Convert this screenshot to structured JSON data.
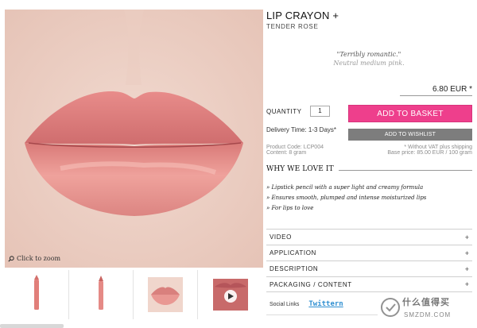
{
  "product": {
    "title": "LIP CRAYON +",
    "shade": "TENDER ROSE",
    "quote_primary": "\"Terribly romantic.\"",
    "quote_secondary": "Neutral medium pink.",
    "price": "6.80 EUR *"
  },
  "purchase": {
    "quantity_label": "QUANTITY",
    "quantity_value": "1",
    "add_to_basket": "ADD TO BASKET",
    "add_to_wishlist": "ADD TO WISHLIST",
    "delivery_time": "Delivery Time: 1-3 Days*"
  },
  "meta": {
    "product_code": "Product Code: LCP004",
    "content": "Content: 8 gram",
    "vat_note": "* Without VAT plus shipping",
    "base_price": "Base price: 85.00 EUR / 100 gram"
  },
  "why_we_love_it": {
    "heading": "WHY WE LOVE IT",
    "points": [
      "» Lipstick pencil with a super light and creamy formula",
      "» Ensures smooth, plumped and intense moisturized lips",
      "» For lips to love"
    ]
  },
  "accordion": [
    {
      "label": "VIDEO",
      "icon": "+"
    },
    {
      "label": "APPLICATION",
      "icon": "+"
    },
    {
      "label": "DESCRIPTION",
      "icon": "+"
    },
    {
      "label": "PACKAGING / CONTENT",
      "icon": "+"
    }
  ],
  "social": {
    "label": "Social Links",
    "twitter": "Twittern"
  },
  "gallery": {
    "zoom_hint": "Click to zoom",
    "thumbnails": [
      "lip-crayon-pencil-angled",
      "lip-crayon-pencil-upright",
      "lips-swatch",
      "video-thumbnail"
    ]
  },
  "watermark": {
    "text": "什么值得买",
    "sub": "SMZDM.COM"
  },
  "colors": {
    "accent_pink": "#ee3f8c",
    "wishlist_grey": "#7d7d7d",
    "link_blue": "#2f8fd1",
    "lip_color": "#e58a86"
  }
}
